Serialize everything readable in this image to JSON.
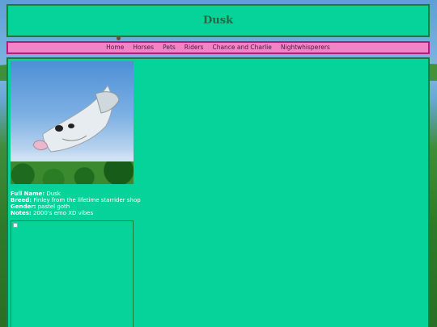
{
  "header": {
    "title": "Dusk"
  },
  "nav": {
    "items": [
      "Home",
      "Horses",
      "Pets",
      "Riders",
      "Chance and Charlie",
      "Nightwhisperers"
    ]
  },
  "profile": {
    "fields": [
      {
        "label": "Full Name:",
        "value": "Dusk"
      },
      {
        "label": "Breed:",
        "value": "Finley from the lifetime starrider shop"
      },
      {
        "label": "Gender:",
        "value": "pastel goth"
      },
      {
        "label": "Notes:",
        "value": "2000's emo XD vibes"
      }
    ]
  },
  "colors": {
    "panel": "#05d39a",
    "panel_border": "#1e7a3c",
    "nav_bg": "#f283c6",
    "nav_border": "#b01e7e",
    "title_text": "#1f6b45"
  }
}
